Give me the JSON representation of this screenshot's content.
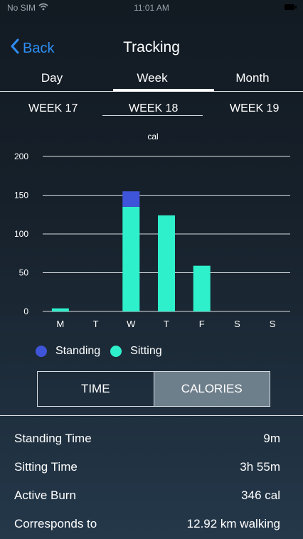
{
  "status_bar": {
    "carrier": "No SIM",
    "time": "11:01 AM"
  },
  "nav": {
    "back_label": "Back",
    "title": "Tracking"
  },
  "tabs": [
    {
      "label": "Day"
    },
    {
      "label": "Week",
      "selected": true
    },
    {
      "label": "Month"
    }
  ],
  "weeks": {
    "prev": "WEEK 17",
    "current": "WEEK 18",
    "next": "WEEK 19"
  },
  "colors": {
    "standing": "#3f55d9",
    "sitting": "#2ef0cb",
    "accent": "#2f8ef4"
  },
  "chart_data": {
    "type": "bar",
    "stacked": true,
    "ylabel": "cal",
    "ylim": [
      0,
      200
    ],
    "yticks": [
      0,
      50,
      100,
      150,
      200
    ],
    "categories": [
      "M",
      "T",
      "W",
      "T",
      "F",
      "S",
      "S"
    ],
    "series": [
      {
        "name": "Sitting",
        "values": [
          4,
          0,
          135,
          124,
          59,
          0,
          0
        ],
        "color": "#2ef0cb"
      },
      {
        "name": "Standing",
        "values": [
          0,
          0,
          20,
          0,
          0,
          0,
          0
        ],
        "color": "#3f55d9"
      }
    ],
    "grid": true,
    "legend": "bottom"
  },
  "legend": {
    "standing": "Standing",
    "sitting": "Sitting"
  },
  "toggle": {
    "time": "TIME",
    "calories": "CALORIES",
    "selected": "CALORIES"
  },
  "stats": [
    {
      "label": "Standing Time",
      "value": "9m"
    },
    {
      "label": "Sitting Time",
      "value": "3h 55m"
    },
    {
      "label": "Active Burn",
      "value": "346 cal"
    },
    {
      "label": "Corresponds to",
      "value": "12.92 km walking"
    }
  ]
}
